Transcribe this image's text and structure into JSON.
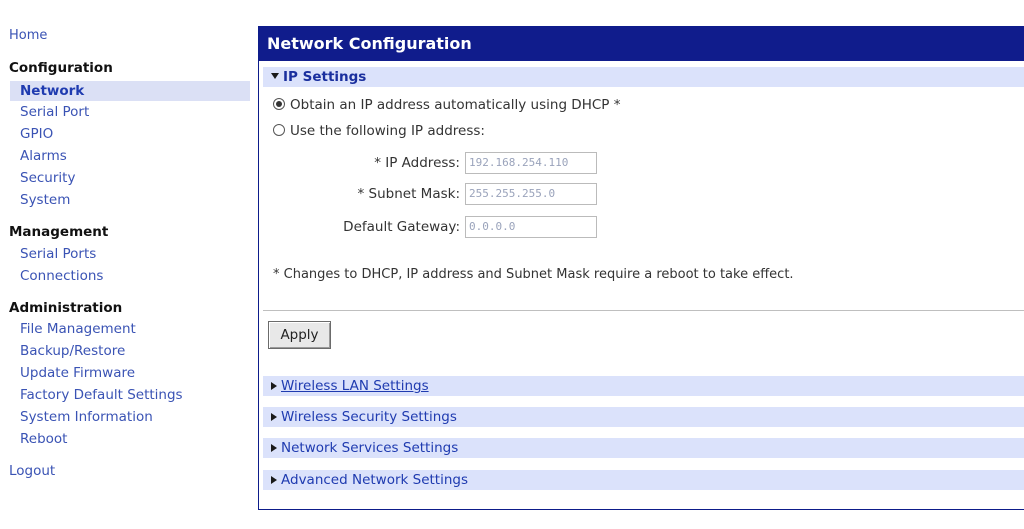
{
  "sidebar": {
    "home": "Home",
    "configuration": {
      "heading": "Configuration",
      "items": [
        "Network",
        "Serial Port",
        "GPIO",
        "Alarms",
        "Security",
        "System"
      ]
    },
    "management": {
      "heading": "Management",
      "items": [
        "Serial Ports",
        "Connections"
      ]
    },
    "administration": {
      "heading": "Administration",
      "items": [
        "File Management",
        "Backup/Restore",
        "Update Firmware",
        "Factory Default Settings",
        "System Information",
        "Reboot"
      ]
    },
    "logout": "Logout"
  },
  "panel": {
    "title": "Network Configuration",
    "ip_settings": {
      "heading": "IP Settings",
      "dhcp_option": "Obtain an IP address automatically using DHCP *",
      "static_option": "Use the following IP address:",
      "fields": [
        {
          "label": "* IP Address:",
          "value": "192.168.254.110"
        },
        {
          "label": "* Subnet Mask:",
          "value": "255.255.255.0"
        },
        {
          "label": "Default Gateway:",
          "value": "0.0.0.0"
        }
      ],
      "note": "* Changes to DHCP, IP address and Subnet Mask require a reboot to take effect.",
      "apply_label": "Apply"
    },
    "sections": [
      "Wireless LAN Settings",
      "Wireless Security Settings",
      "Network Services Settings",
      "Advanced Network Settings"
    ]
  },
  "colors": {
    "header_bg": "#101c8c",
    "section_bg": "#dbe2fb",
    "link": "#3a53b4",
    "active_bg": "#dbe0f5"
  }
}
